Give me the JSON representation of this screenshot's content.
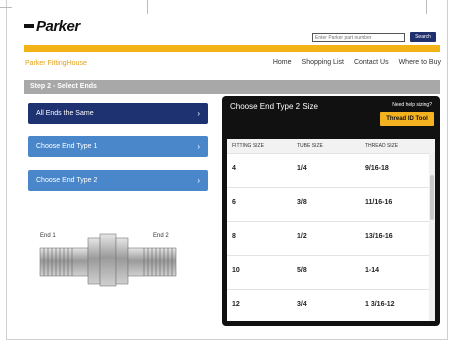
{
  "header": {
    "logo_text": "Parker",
    "search_placeholder": "Enter Parker part number",
    "search_button": "Search"
  },
  "site": {
    "title": "Parker FittingHouse",
    "nav": [
      "Home",
      "Shopping List",
      "Contact Us",
      "Where to Buy"
    ]
  },
  "step": {
    "label": "Step 2 - Select Ends"
  },
  "left_menu": [
    {
      "label": "All Ends the Same",
      "selected": true
    },
    {
      "label": "Choose End Type 1",
      "selected": false
    },
    {
      "label": "Choose End Type 2",
      "selected": false
    }
  ],
  "diagram": {
    "end1": "End 1",
    "end2": "End 2"
  },
  "panel": {
    "title": "Choose End Type 2 Size",
    "help_text": "Need help sizing?",
    "tool_button": "Thread ID Tool",
    "columns": [
      "FITTING SIZE",
      "TUBE SIZE",
      "THREAD SIZE"
    ],
    "rows": [
      [
        "4",
        "1/4",
        "9/16-18"
      ],
      [
        "6",
        "3/8",
        "11/16-16"
      ],
      [
        "8",
        "1/2",
        "13/16-16"
      ],
      [
        "10",
        "5/8",
        "1-14"
      ],
      [
        "12",
        "3/4",
        "1 3/16-12"
      ]
    ]
  },
  "colors": {
    "accent": "#f3b316",
    "navy": "#1e3170",
    "blue": "#4a87ca"
  }
}
